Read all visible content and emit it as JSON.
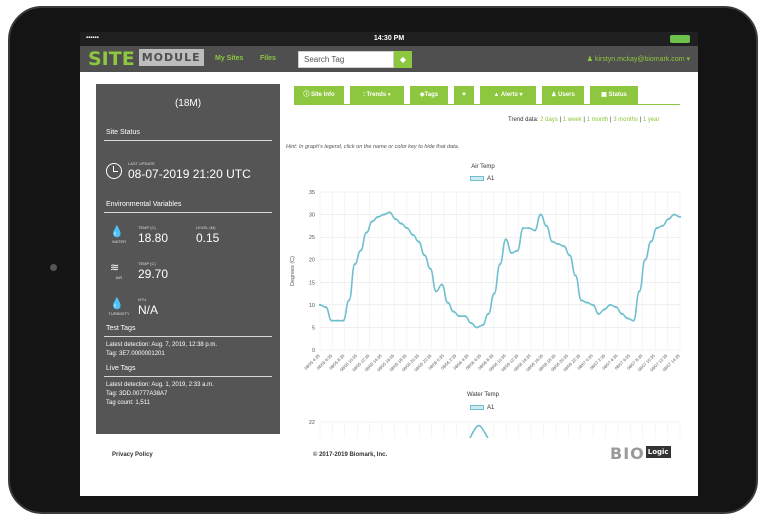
{
  "status_bar": {
    "signal": "▪▪▪▪▪▪",
    "time": "14:30 PM"
  },
  "nav": {
    "logo_main": "SITE",
    "logo_module": "MODULE",
    "my_sites": "My Sites",
    "files": "Files",
    "search_placeholder": "Search Tag",
    "search_icon": "tag-icon",
    "user": "kirstyn.mckay@biomark.com ▾"
  },
  "sidebar": {
    "title": "(18M)",
    "site_status": "Site Status",
    "last_update_label": "LAST UPDATE",
    "last_update": "08-07-2019 21:20 UTC",
    "env_heading": "Environmental Variables",
    "water": {
      "caption": "WATER",
      "temp_label": "TEMP (C)",
      "temp": "18.80",
      "level_label": "LEVEL (M)",
      "level": "0.15"
    },
    "air": {
      "caption": "AIR",
      "temp_label": "TEMP (C)",
      "temp": "29.70"
    },
    "turbidity": {
      "caption": "TURBIDITY",
      "label": "NTU",
      "value": "N/A"
    },
    "test_tags": {
      "heading": "Test Tags",
      "detection": "Latest detection: Aug. 7, 2019, 12:38 p.m.",
      "tag": "Tag: 3E7.0000001201"
    },
    "live_tags": {
      "heading": "Live Tags",
      "detection": "Latest detection: Aug. 1, 2019, 2:33 a.m.",
      "tag": "Tag: 3DD.00777A38A7",
      "count": "Tag count: 1,511"
    }
  },
  "tabs": [
    {
      "label": "Site Info"
    },
    {
      "label": "Trends ▾"
    },
    {
      "label": "Tags"
    },
    {
      "label": ""
    },
    {
      "label": "Alerts ▾"
    },
    {
      "label": "Users"
    },
    {
      "label": "Status"
    }
  ],
  "trend": {
    "label": "Trend data:",
    "options": [
      "2 days",
      "1 week",
      "1 month",
      "3 months",
      "1 year"
    ]
  },
  "hint": "Hint: In graph's legend, click on the name or color key to hide that data.",
  "colors": {
    "accent": "#8dc63f",
    "sidebar": "#555555",
    "line": "#6fbfcf"
  },
  "chart_data": [
    {
      "type": "line",
      "title": "Air Temp",
      "ylabel": "Degrees (C)",
      "ylim": [
        0,
        35
      ],
      "yticks": [
        0,
        5,
        10,
        15,
        20,
        25,
        30,
        35
      ],
      "grid": true,
      "legend": "top",
      "series": [
        {
          "name": "A1",
          "values": [
            10,
            9.5,
            6.5,
            6.5,
            6.5,
            11,
            19,
            22,
            26,
            28.5,
            29.5,
            30,
            30.5,
            29,
            28,
            27,
            25.5,
            24,
            21,
            18,
            13,
            14.5,
            10.5,
            8.5,
            7.5,
            7.5,
            6,
            5,
            5.5,
            8,
            12.5,
            19,
            24.5,
            21.5,
            22,
            27,
            27,
            26.5,
            30,
            27.5,
            24,
            23.5,
            23,
            21,
            16.5,
            11,
            10.5,
            10,
            8,
            9,
            10,
            9.5,
            8,
            7,
            6.5,
            13,
            20,
            24,
            27,
            27.5,
            29,
            30,
            29.5
          ]
        }
      ],
      "x_tick_labels": [
        "08/05 4:35",
        "08/05 6:35",
        "08/05 8:35",
        "08/05 10:35",
        "08/05 12:35",
        "08/05 14:35",
        "08/05 16:35",
        "08/05 18:35",
        "08/05 20:35",
        "08/05 22:35",
        "08/06 0:35",
        "08/06 2:35",
        "08/06 4:35",
        "08/06 6:35",
        "08/06 8:35",
        "08/06 10:35",
        "08/06 12:35",
        "08/06 14:35",
        "08/06 16:35",
        "08/06 18:35",
        "08/06 20:35",
        "08/06 22:35",
        "08/07 0:35",
        "08/07 2:35",
        "08/07 4:35",
        "08/07 6:35",
        "08/07 8:35",
        "08/07 10:35",
        "08/07 12:35",
        "08/07 14:35"
      ]
    },
    {
      "type": "line",
      "title": "Water Temp",
      "ylim": [
        0,
        22
      ],
      "yticks": [
        22
      ],
      "legend": "top",
      "series": [
        {
          "name": "A1",
          "values": [
            18.8
          ]
        }
      ]
    }
  ],
  "footer": {
    "privacy": "Privacy Policy",
    "copyright": "© 2017-2019 Biomark, Inc.",
    "logo_main": "BIO",
    "logo_box": "Logic"
  }
}
